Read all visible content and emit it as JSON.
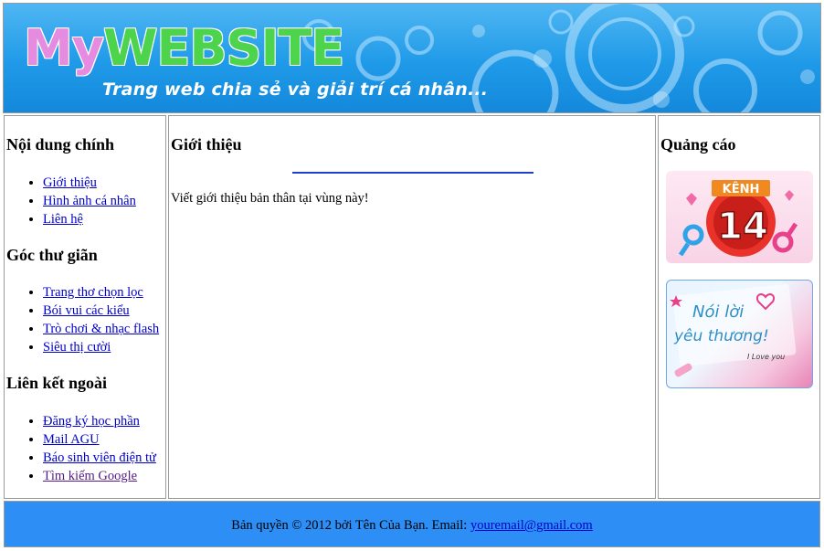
{
  "header": {
    "logo_part1": "My",
    "logo_part2": "WEBSITE",
    "slogan": "Trang web chia sẻ và giải trí cá nhân..."
  },
  "left": {
    "sections": [
      {
        "title": "Nội dung chính",
        "items": [
          "Giới thiệu",
          "Hình ảnh cá nhân",
          "Liên hệ"
        ]
      },
      {
        "title": "Góc thư giãn",
        "items": [
          "Trang thơ chọn lọc",
          "Bói vui các kiểu",
          "Trò chơi & nhạc flash",
          "Siêu thị cười"
        ]
      },
      {
        "title": "Liên kết ngoài",
        "items": [
          "Đăng ký học phần",
          "Mail AGU",
          "Báo sinh viên điện tử",
          "Tìm kiếm Google"
        ]
      }
    ]
  },
  "main": {
    "title": "Giới thiệu",
    "text": "Viết giới thiệu bản thân tại vùng này!"
  },
  "right": {
    "title": "Quảng cáo",
    "ad1": {
      "top": "KÊNH",
      "number": "14"
    },
    "ad2": {
      "line1": "Nói lời",
      "line2": "yêu thương!",
      "sign": "I Love you"
    }
  },
  "footer": {
    "text": "Bản quyền © 2012 bởi Tên Của Bạn. Email: ",
    "email": "youremail@gmail.com"
  },
  "colors": {
    "header_blue": "#1f9ae8",
    "footer_blue": "#2d8ff5",
    "link": "#0000cc"
  }
}
